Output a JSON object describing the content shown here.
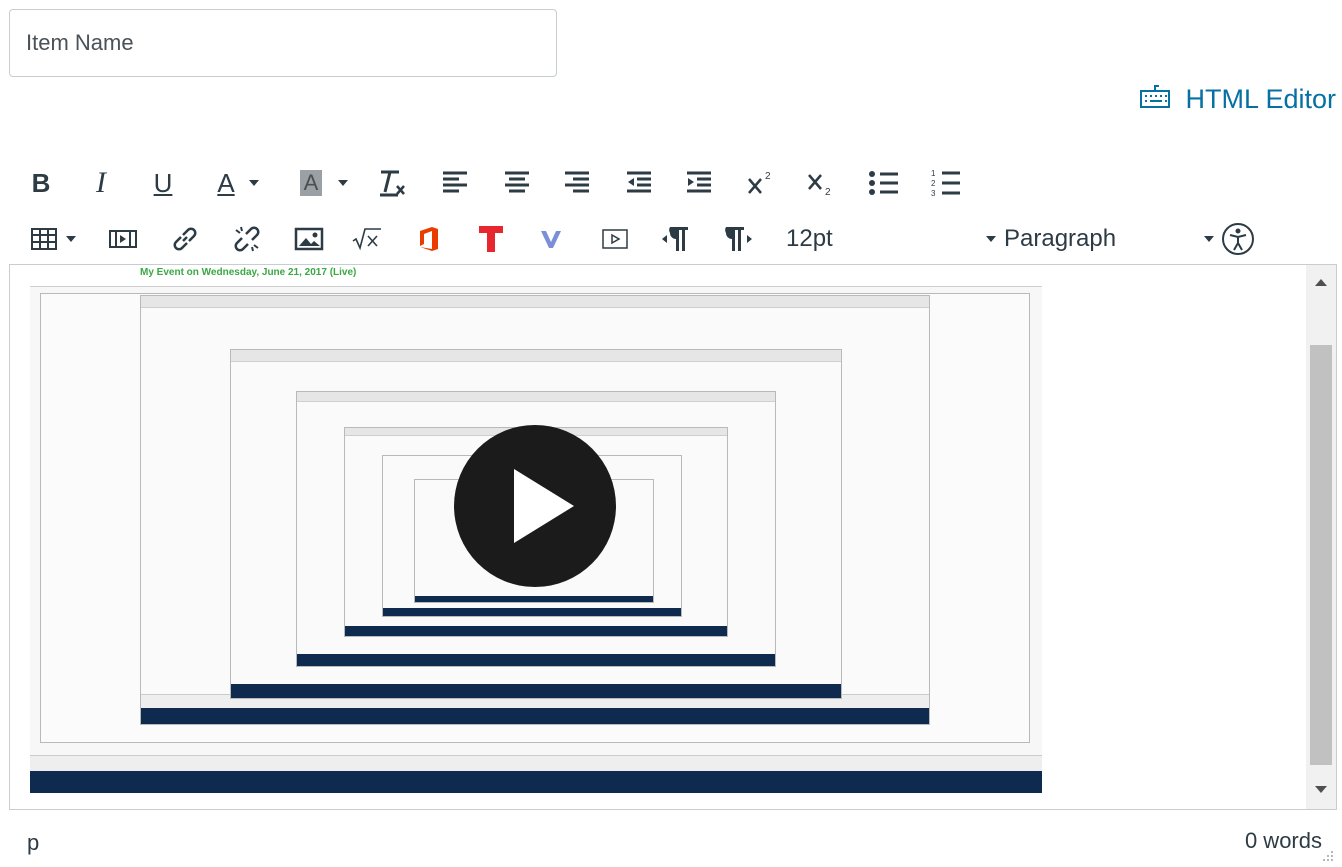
{
  "item_name": {
    "placeholder": "Item Name",
    "value": ""
  },
  "html_editor": {
    "label": "HTML Editor",
    "icon": "keyboard-icon"
  },
  "toolbar": {
    "row1": [
      "bold",
      "italic",
      "underline",
      "font-color",
      "background-color",
      "clear-formatting",
      "align-left",
      "align-center",
      "align-right",
      "outdent",
      "indent",
      "superscript",
      "subscript",
      "bullet-list",
      "numbered-list"
    ],
    "row2": [
      "table",
      "media",
      "link",
      "unlink",
      "image",
      "math-equation",
      "office365",
      "text-tool",
      "vimeo-tool",
      "video-embed",
      "ltr-paragraph",
      "rtl-paragraph",
      "accessibility-checker"
    ],
    "bold_glyph": "B",
    "italic_glyph": "I",
    "underline_glyph": "U",
    "font_color_glyph": "A",
    "bg_color_glyph": "A",
    "font_size": "12pt",
    "block_format": "Paragraph"
  },
  "content": {
    "video_title": "My Event on Wednesday, June 21, 2017 (Live)",
    "colors": {
      "event_green": "#3aa843",
      "taskbar": "#0e2b4f",
      "link_blue": "#0770a3"
    }
  },
  "status": {
    "path": "p",
    "word_count": "0 words"
  }
}
